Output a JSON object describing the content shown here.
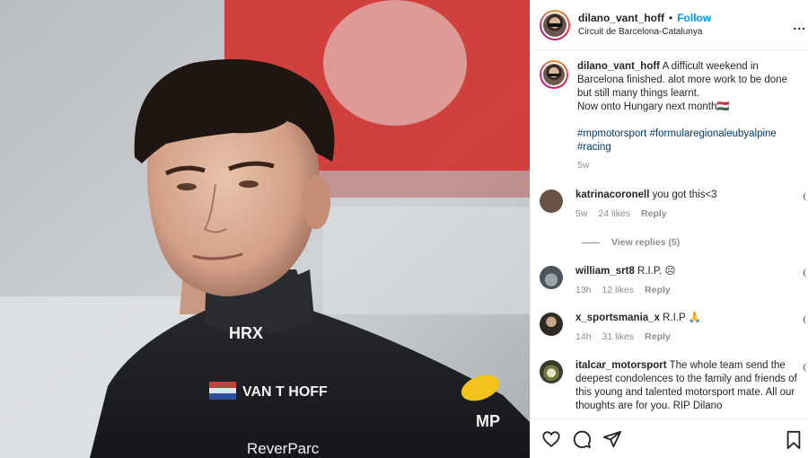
{
  "post": {
    "username": "dilano_vant_hoff",
    "follow_label": "Follow",
    "location": "Circuit de Barcelona-Catalunya",
    "more_label": "...",
    "caption": {
      "username": "dilano_vant_hoff",
      "text": "A difficult weekend in Barcelona finished. alot more work to be done but still many things learnt.",
      "text2": "Now onto Hungary next month🇭🇺",
      "hashtags": "#mpmotorsport #formularegionaleubyalpine #racing",
      "age": "5w"
    }
  },
  "photo": {
    "suit_brand": "HRX",
    "suit_name": "VAN T HOFF",
    "sponsor": "ReverParc",
    "badge": "MP"
  },
  "comments": [
    {
      "username": "katrinacoronell",
      "text": "you got this<3",
      "age": "5w",
      "likes": "24 likes",
      "reply": "Reply",
      "avatar_color": "#6b5247"
    },
    {
      "username": "william_srt8",
      "text": "R.I.P. ☹",
      "age": "13h",
      "likes": "12 likes",
      "reply": "Reply",
      "avatar_color": "#5c6770"
    },
    {
      "username": "x_sportsmania_x",
      "text": "R.I.P 🙏",
      "age": "14h",
      "likes": "31 likes",
      "reply": "Reply",
      "avatar_color": "#3a3530"
    },
    {
      "username": "italcar_motorsport",
      "text": "The whole team send the deepest condolences to the family and friends of this young and talented motorsport mate. All our thoughts are for you. RIP Dilano",
      "age": "",
      "likes": "",
      "reply": "",
      "avatar_color": "#7a6a4a"
    }
  ],
  "view_replies_label": "View replies (5)",
  "icons": [
    "heart-icon",
    "comment-icon",
    "share-icon",
    "bookmark-icon",
    "more-icon",
    "like-comment-icon"
  ]
}
